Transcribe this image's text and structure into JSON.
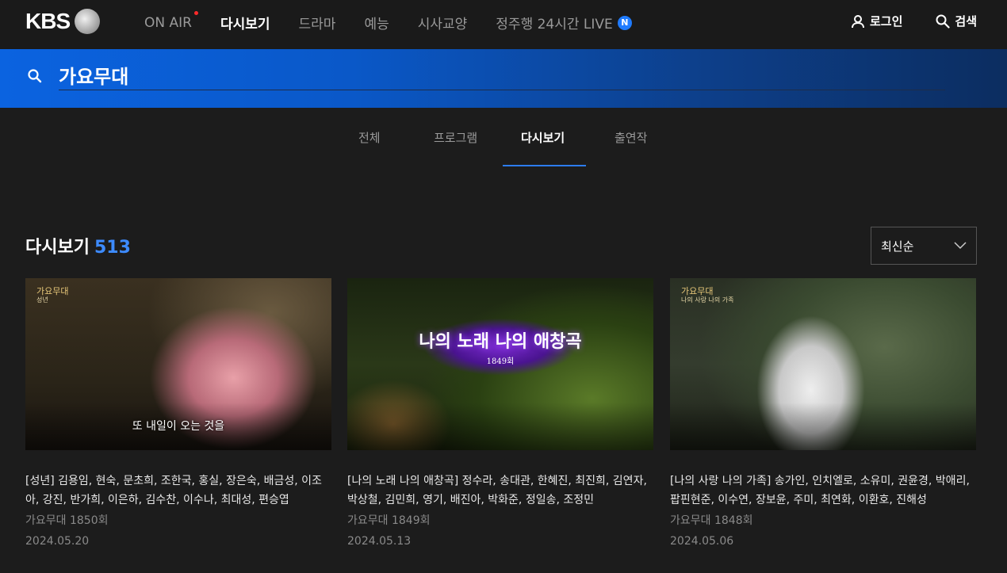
{
  "nav": {
    "logo": "KBS",
    "items": [
      {
        "label": "ON AIR",
        "active": false,
        "dot": true
      },
      {
        "label": "다시보기",
        "active": true
      },
      {
        "label": "드라마",
        "active": false
      },
      {
        "label": "예능",
        "active": false
      },
      {
        "label": "시사교양",
        "active": false
      },
      {
        "label": "정주행 24시간 LIVE",
        "active": false,
        "badge": "N"
      }
    ],
    "login": "로그인",
    "search": "검색"
  },
  "search": {
    "query": "가요무대"
  },
  "tabs": [
    {
      "label": "전체"
    },
    {
      "label": "프로그램"
    },
    {
      "label": "다시보기",
      "active": true
    },
    {
      "label": "출연작"
    }
  ],
  "section": {
    "title": "다시보기",
    "count": "513",
    "sort": "최신순"
  },
  "cards": [
    {
      "thumb_logo": "가요무대",
      "thumb_sublogo": "성년",
      "thumb_caption": "또 내일이 오는 것을",
      "title": "[성년] 김용임, 현숙, 문초희, 조한국, 홍실, 장은숙, 배금성, 이조아, 강진, 반가희, 이은하, 김수찬, 이수나, 최대성, 편승엽",
      "program": "가요무대 1850회",
      "date": "2024.05.20"
    },
    {
      "thumb_title": "나의 노래 나의 애창곡",
      "thumb_episode": "1849회",
      "title": "[나의 노래 나의 애창곡] 정수라, 송대관, 한혜진, 최진희, 김연자, 박상철, 김민희, 영기, 배진아, 박화준, 정일송, 조정민",
      "program": "가요무대 1849회",
      "date": "2024.05.13"
    },
    {
      "thumb_logo": "가요무대",
      "thumb_sublogo": "나의 사랑 나의 가족",
      "title": "[나의 사랑 나의 가족] 송가인, 인치엘로, 소유미, 권윤경, 박애리, 팝핀현준, 이수연, 장보윤, 주미, 최연화, 이환호, 진해성",
      "program": "가요무대 1848회",
      "date": "2024.05.06"
    }
  ],
  "colors": {
    "accent": "#2d7cf0",
    "count": "#3d8bff",
    "live_dot": "#ff2a2a",
    "background": "#1c1c1c"
  },
  "icons": {
    "user": "user-icon",
    "search": "search-icon",
    "sort": "chevron-down-icon"
  }
}
